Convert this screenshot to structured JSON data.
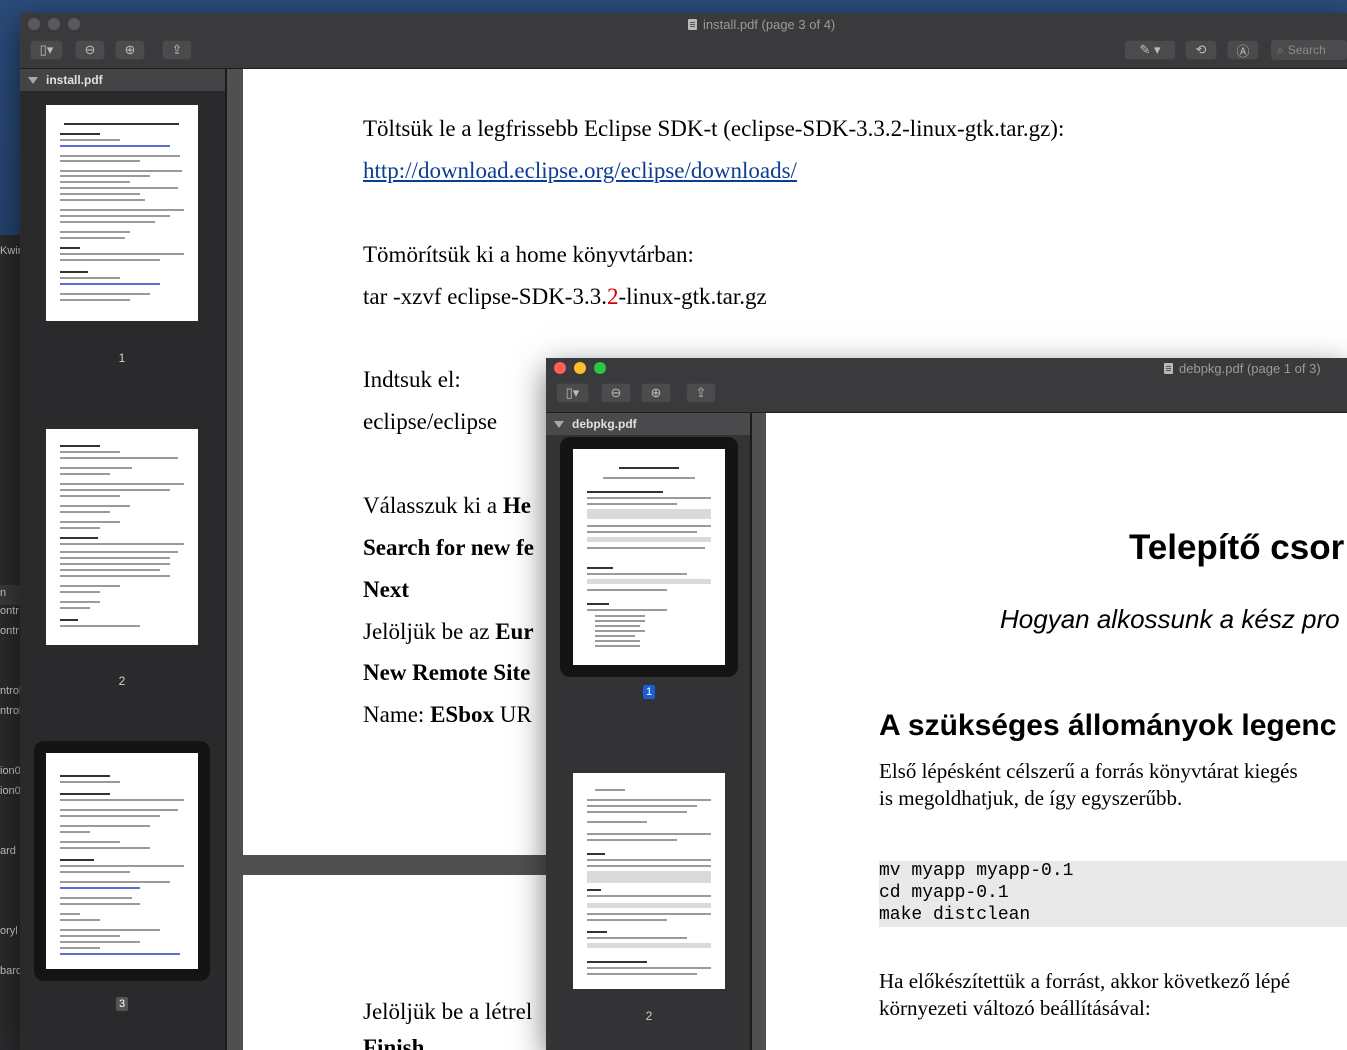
{
  "background": {
    "fragments": [
      "Kwin",
      "n",
      "ontr",
      "ontr",
      "ntrol",
      "ntrol",
      "ion0",
      "ion0",
      "ard",
      "oryl",
      "bard"
    ]
  },
  "install_window": {
    "title": "install.pdf (page 3 of 4)",
    "search_placeholder": "Search",
    "sidebar_title": "install.pdf",
    "thumbnails": [
      {
        "page": "1",
        "heading": "Maemo fejlesztői környezet telepítése"
      },
      {
        "page": "2",
        "heading": "Az SDK használata"
      },
      {
        "page": "3",
        "heading": "C++ fejlesztői környezet"
      }
    ],
    "content": {
      "line1": "Töltsük le a legfrissebb Eclipse SDK-t (eclipse-SDK-3.3.2-linux-gtk.tar.gz):",
      "link": "http://download.eclipse.org/eclipse/downloads/",
      "line3": "Tömörítsük ki a home könyvtárban:",
      "line4_a": "tar -xzvf eclipse-SDK-3.3.",
      "line4_red": "2",
      "line4_b": "-linux-gtk.tar.gz",
      "line5": "Indtsuk el:",
      "line6": "eclipse/eclipse",
      "line7_a": "Válasszuk ki a ",
      "line7_b": "He",
      "line8": "Search for new fe",
      "line9": "Next",
      "line10_a": "Jelöljük be az ",
      "line10_b": "Eur",
      "line11": "New Remote Site",
      "line12_a": "Name: ",
      "line12_b": "ESbox",
      "line12_c": " UR",
      "next_page_line1": "Jelöljük be a létrel",
      "next_page_line2": "Finish"
    }
  },
  "debpkg_window": {
    "title": "debpkg.pdf (page 1 of 3)",
    "sidebar_title": "debpkg.pdf",
    "thumbnails": [
      {
        "page": "1",
        "heading": "Telepítő csomag készítése",
        "subheading": "Hogyan alkossunk a kész projektünkből debian csomagot"
      },
      {
        "page": "2",
        "heading": ""
      }
    ],
    "content": {
      "title": "Telepítő csor",
      "subtitle": "Hogyan alkossunk a kész pro",
      "heading": "A szükséges állományok legenc",
      "para1_line1": "Első lépésként célszerű a forrás könyvtárat kiegés",
      "para1_line2": "is megoldhatjuk, de így egyszerűbb.",
      "code1": "mv myapp myapp-0.1",
      "code2": "cd myapp-0.1",
      "code3": "make distclean",
      "para2_line1": "Ha előkészítettük a forrást, akkor következő lépé",
      "para2_line2": "környezeti változó beállításával:"
    }
  }
}
